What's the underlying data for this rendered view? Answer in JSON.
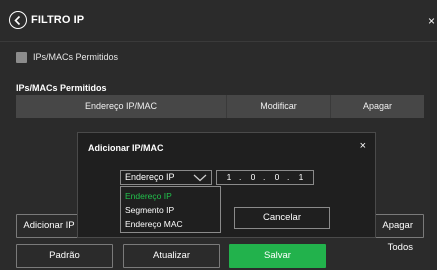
{
  "header": {
    "title": "FILTRO IP",
    "close_glyph": "×"
  },
  "permitted_checkbox": {
    "label": "IPs/MACs Permitidos",
    "checked": false
  },
  "section": {
    "title": "IPs/MACs Permitidos"
  },
  "table": {
    "columns": [
      "Endereço IP/MAC",
      "Modificar",
      "Apagar"
    ],
    "rows": []
  },
  "buttons": {
    "add": "Adicionar IP",
    "delete_all": "Apagar Todos",
    "default": "Padrão",
    "update": "Atualizar",
    "save": "Salvar"
  },
  "modal": {
    "title": "Adicionar IP/MAC",
    "close_glyph": "×",
    "type_selected": "Endereço IP",
    "type_options": [
      "Endereço IP",
      "Segmento IP",
      "Endereço MAC"
    ],
    "ip_octets": [
      "1",
      "0",
      "0",
      "1"
    ],
    "cancel": "Cancelar"
  },
  "colors": {
    "background": "#2b2b2b",
    "accent_green": "#22b24c",
    "modal_bg": "#1f1f1f"
  },
  "icons": {
    "back": "chevron-left-circle-icon",
    "dropdown": "chevron-down-icon",
    "close": "close-icon"
  }
}
